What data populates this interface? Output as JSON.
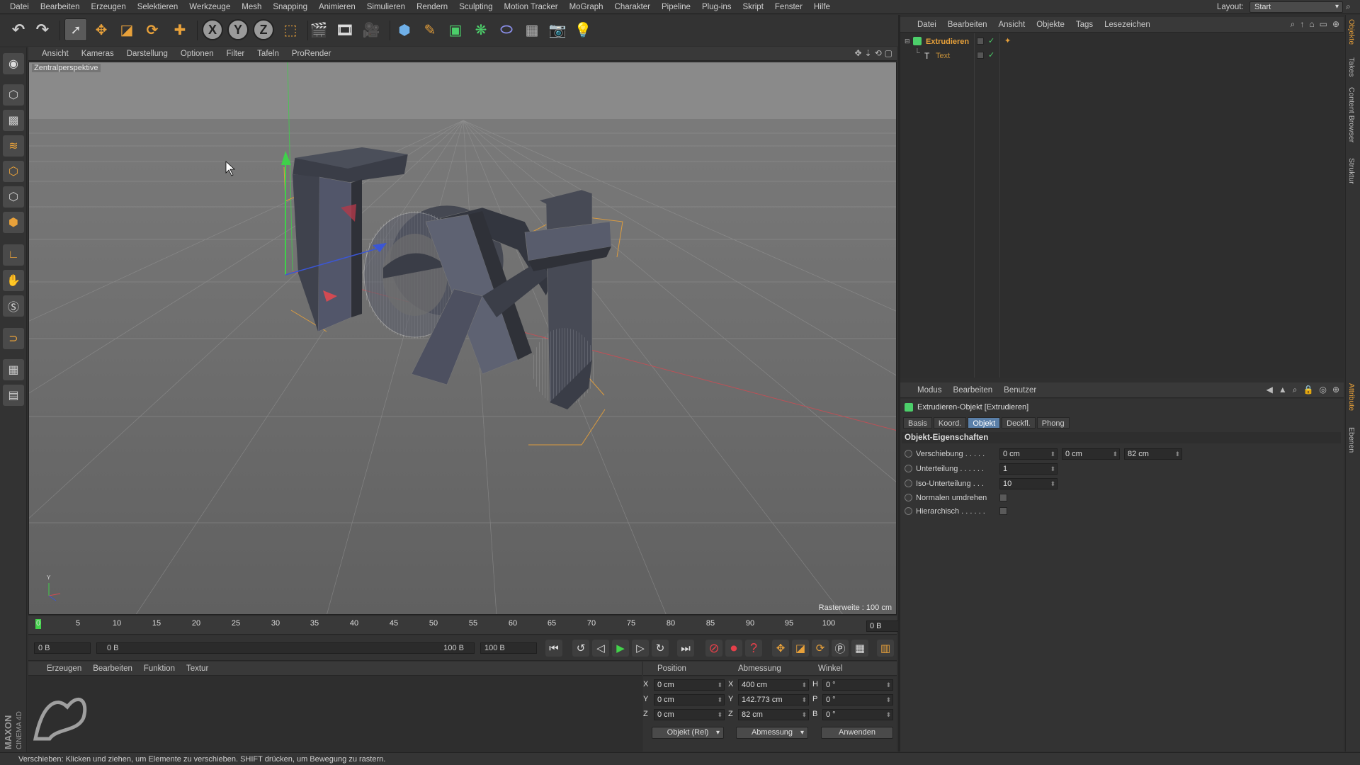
{
  "menubar": {
    "items": [
      "Datei",
      "Bearbeiten",
      "Erzeugen",
      "Selektieren",
      "Werkzeuge",
      "Mesh",
      "Snapping",
      "Animieren",
      "Simulieren",
      "Rendern",
      "Sculpting",
      "Motion Tracker",
      "MoGraph",
      "Charakter",
      "Pipeline",
      "Plug-ins",
      "Skript",
      "Fenster",
      "Hilfe"
    ],
    "layout_label": "Layout:",
    "layout_value": "Start"
  },
  "toolbar": {
    "undo_icon": "undo-icon",
    "redo_icon": "redo-icon",
    "axis_x": "X",
    "axis_y": "Y",
    "axis_z": "Z"
  },
  "viewport": {
    "menu": [
      "Ansicht",
      "Kameras",
      "Darstellung",
      "Optionen",
      "Filter",
      "Tafeln",
      "ProRender"
    ],
    "camera_label": "Zentralperspektive",
    "grid_label": "Rasterweite : 100 cm",
    "object_text": "Text"
  },
  "timeline": {
    "ticks": [
      "0",
      "5",
      "10",
      "15",
      "20",
      "25",
      "30",
      "35",
      "40",
      "45",
      "50",
      "55",
      "60",
      "65",
      "70",
      "75",
      "80",
      "85",
      "90",
      "95",
      "100"
    ],
    "current_frame": "0 B"
  },
  "transport": {
    "start_field": "0 B",
    "range_start": "0 B",
    "range_end": "100 B",
    "end_field": "100 B"
  },
  "material_manager": {
    "menu": [
      "Erzeugen",
      "Bearbeiten",
      "Funktion",
      "Textur"
    ]
  },
  "coord_manager": {
    "headers": {
      "position": "Position",
      "size": "Abmessung",
      "rotation": "Winkel"
    },
    "position": {
      "x_label": "X",
      "y_label": "Y",
      "z_label": "Z",
      "x": "0 cm",
      "y": "0 cm",
      "z": "0 cm"
    },
    "size": {
      "x_label": "X",
      "y_label": "Y",
      "z_label": "Z",
      "x": "400 cm",
      "y": "142.773 cm",
      "z": "82 cm"
    },
    "rotation": {
      "h_label": "H",
      "p_label": "P",
      "b_label": "B",
      "h": "0 °",
      "p": "0 °",
      "b": "0 °"
    },
    "mode_dropdown": "Objekt (Rel)",
    "size_dropdown": "Abmessung",
    "apply_label": "Anwenden"
  },
  "object_manager": {
    "menu": [
      "Datei",
      "Bearbeiten",
      "Ansicht",
      "Objekte",
      "Tags",
      "Lesezeichen"
    ],
    "objects": [
      {
        "name": "Extrudieren",
        "color": "#e8a13a"
      },
      {
        "name": "Text",
        "color": "#c8923a"
      }
    ]
  },
  "attributes": {
    "menu": [
      "Modus",
      "Bearbeiten",
      "Benutzer"
    ],
    "title": "Extrudieren-Objekt [Extrudieren]",
    "tabs": [
      "Basis",
      "Koord.",
      "Objekt",
      "Deckfl.",
      "Phong"
    ],
    "active_tab": "Objekt",
    "section": "Objekt-Eigenschaften",
    "verschiebung_label": "Verschiebung . . . . .",
    "verschiebung": [
      "0 cm",
      "0 cm",
      "82 cm"
    ],
    "unterteilung_label": "Unterteilung . . . . . .",
    "unterteilung": "1",
    "iso_label": "Iso-Unterteilung . . .",
    "iso": "10",
    "normalen_label": "Normalen umdrehen",
    "hierarchisch_label": "Hierarchisch . . . . . ."
  },
  "side_tabs": [
    "Objekte",
    "Takes",
    "Content Browser",
    "Struktur",
    "Attribute",
    "Ebenen"
  ],
  "statusbar": {
    "text": "Verschieben: Klicken und ziehen, um Elemente zu verschieben. SHIFT drücken, um Bewegung zu rastern."
  },
  "branding": {
    "vertical_text": "MAXON CINEMA 4D"
  },
  "colors": {
    "accent": "#e8a13a",
    "active_tab": "#5a7fa8",
    "playhead": "#42d34a",
    "record": "#e6404a"
  }
}
